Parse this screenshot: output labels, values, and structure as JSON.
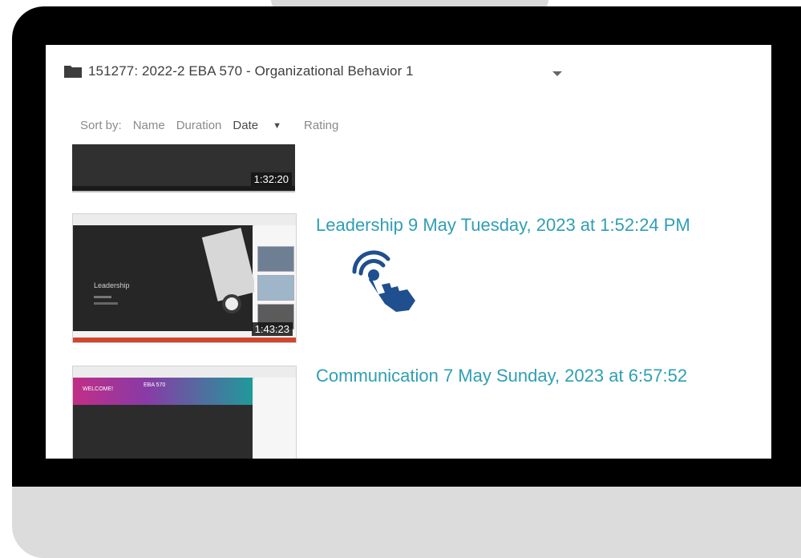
{
  "header": {
    "folder_title": "151277: 2022-2 EBA 570 - Organizational Behavior 1",
    "dropdown_icon": "caret-down-icon",
    "folder_icon": "folder-icon"
  },
  "sort": {
    "label": "Sort by:",
    "options": [
      "Name",
      "Duration",
      "Date",
      "Rating"
    ],
    "active": "Date",
    "active_caret": "▼"
  },
  "videos": [
    {
      "title": "",
      "duration": "1:32:20"
    },
    {
      "title": "Leadership 9 May Tuesday, 2023 at 1:52:24 PM",
      "duration": "1:43:23",
      "thumb_text": "Leadership"
    },
    {
      "title": "Communication 7 May Sunday, 2023 at 6:57:52",
      "duration": "",
      "thumb_text_left": "WELCOME!",
      "thumb_text_right": "EBA 570"
    }
  ],
  "colors": {
    "title_link": "#2f9fb4",
    "cursor": "#1f4f8f",
    "progress_bar": "#d2452f"
  },
  "cursor_icon": "tap-hand-icon"
}
